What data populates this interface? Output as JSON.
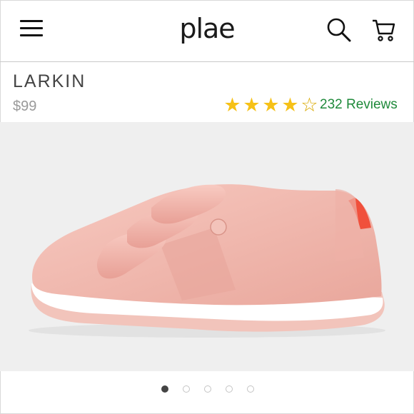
{
  "header": {
    "logo": "plae",
    "icons": [
      "menu-icon",
      "search-icon",
      "cart-icon"
    ]
  },
  "product": {
    "name": "LARKIN",
    "price": "$99",
    "rating_stars": 4,
    "rating_max": 5,
    "reviews_label": "232 Reviews",
    "image": "pink-velcro-sneaker"
  },
  "carousel": {
    "total": 5,
    "active_index": 0
  },
  "colors": {
    "reviews_link": "#1f8a3b",
    "star": "#f6c117",
    "shoe": "#f2b9b0",
    "heel_tab": "#f0503c"
  }
}
